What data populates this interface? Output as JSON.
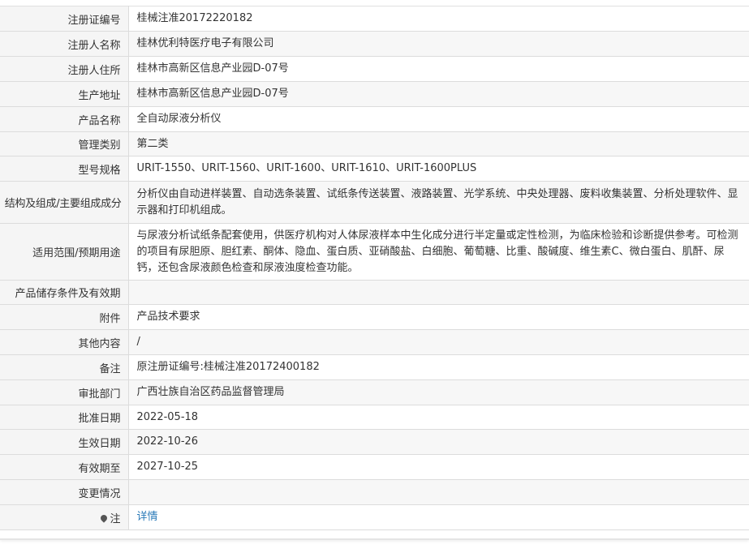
{
  "rows": [
    {
      "label": "注册证编号",
      "value": "桂械注准20172220182"
    },
    {
      "label": "注册人名称",
      "value": "桂林优利特医疗电子有限公司"
    },
    {
      "label": "注册人住所",
      "value": "桂林市高新区信息产业园D-07号"
    },
    {
      "label": "生产地址",
      "value": "桂林市高新区信息产业园D-07号"
    },
    {
      "label": "产品名称",
      "value": "全自动尿液分析仪"
    },
    {
      "label": "管理类别",
      "value": "第二类"
    },
    {
      "label": "型号规格",
      "value": "URIT-1550、URIT-1560、URIT-1600、URIT-1610、URIT-1600PLUS"
    },
    {
      "label": "结构及组成/主要组成成分",
      "value": "分析仪由自动进样装置、自动选条装置、试纸条传送装置、液路装置、光学系统、中央处理器、废料收集装置、分析处理软件、显示器和打印机组成。"
    },
    {
      "label": "适用范围/预期用途",
      "value": "与尿液分析试纸条配套使用，供医疗机构对人体尿液样本中生化成分进行半定量或定性检测，为临床检验和诊断提供参考。可检测的项目有尿胆原、胆红素、酮体、隐血、蛋白质、亚硝酸盐、白细胞、葡萄糖、比重、酸碱度、维生素C、微白蛋白、肌酐、尿钙，还包含尿液颜色检查和尿液浊度检查功能。"
    },
    {
      "label": "产品储存条件及有效期",
      "value": ""
    },
    {
      "label": "附件",
      "value": "产品技术要求"
    },
    {
      "label": "其他内容",
      "value": "/"
    },
    {
      "label": "备注",
      "value": "原注册证编号:桂械注准20172400182"
    },
    {
      "label": "审批部门",
      "value": "广西壮族自治区药品监督管理局"
    },
    {
      "label": "批准日期",
      "value": "2022-05-18"
    },
    {
      "label": "生效日期",
      "value": "2022-10-26"
    },
    {
      "label": "有效期至",
      "value": "2027-10-25"
    },
    {
      "label": "变更情况",
      "value": ""
    },
    {
      "label": "注",
      "value": "详情",
      "icon": "map-pin-icon"
    }
  ]
}
